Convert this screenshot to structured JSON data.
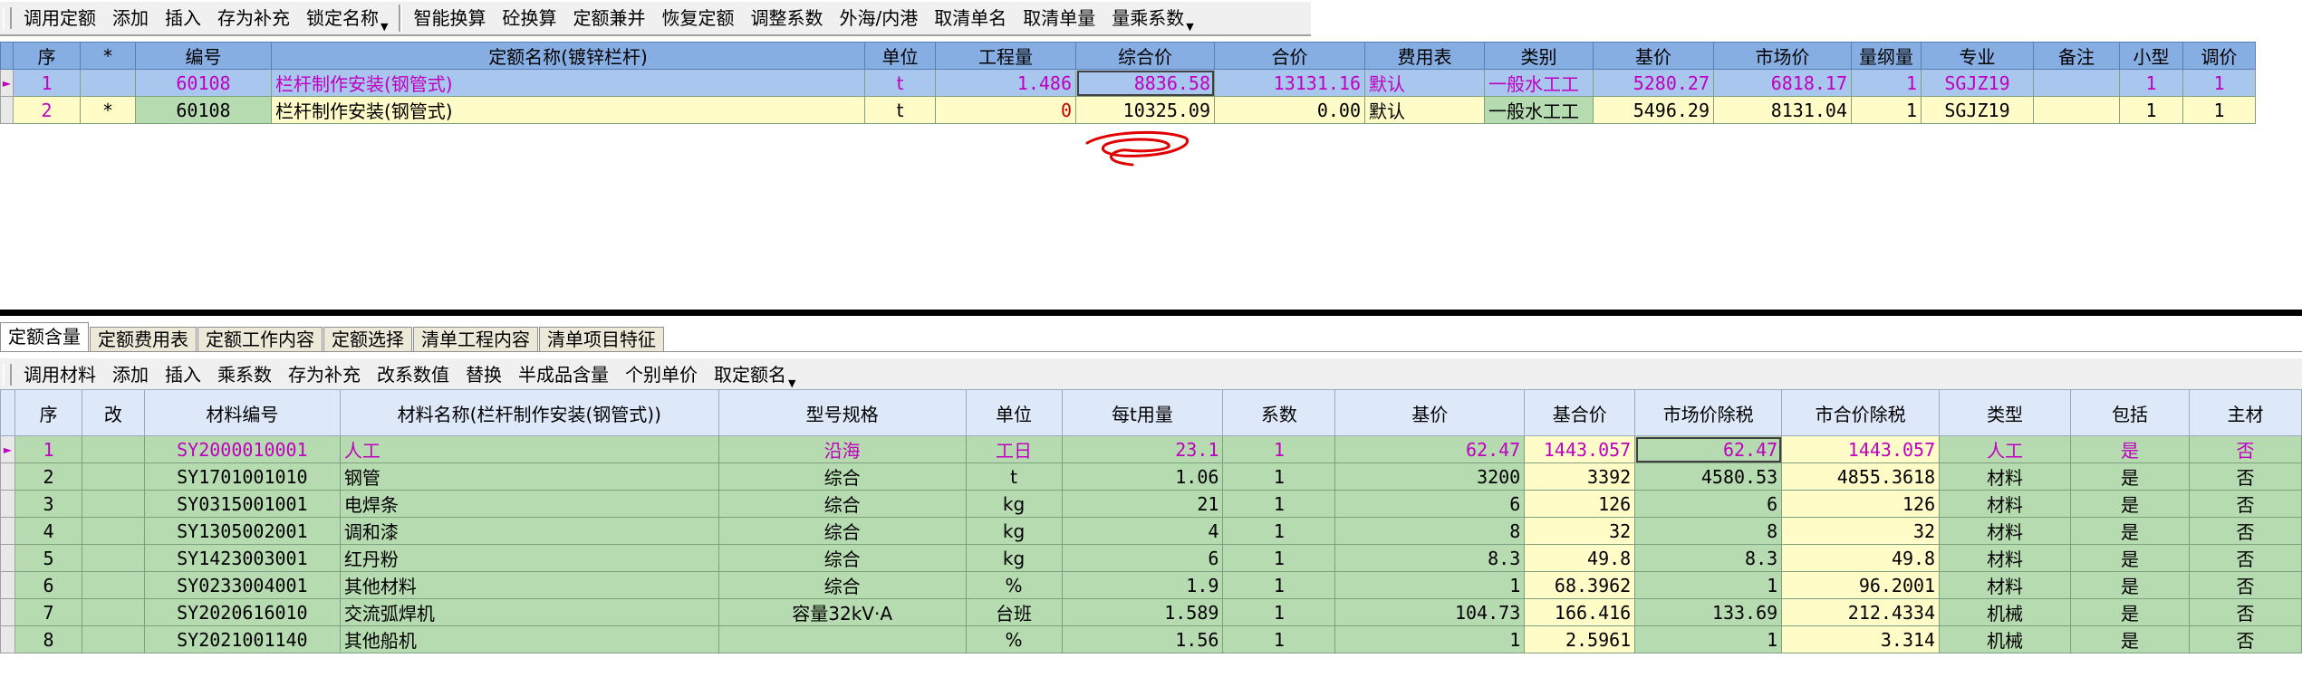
{
  "toolbar_top": {
    "buttons": [
      "调用定额",
      "添加",
      "插入",
      "存为补充",
      "锁定名称",
      "智能换算",
      "砼换算",
      "定额兼并",
      "恢复定额",
      "调整系数",
      "外海/内港",
      "取清单名",
      "取清单量",
      "量乘系数"
    ]
  },
  "top_grid": {
    "headers": [
      "序",
      "*",
      "编号",
      "定额名称(镀锌栏杆)",
      "单位",
      "工程量",
      "综合价",
      "合价",
      "费用表",
      "类别",
      "基价",
      "市场价",
      "量纲量",
      "专业",
      "备注",
      "小型",
      "调价"
    ],
    "rows": [
      {
        "seq": "1",
        "star": "",
        "code": "60108",
        "name": "栏杆制作安装(钢管式)",
        "unit": "t",
        "qty": "1.486",
        "composite": "8836.58",
        "total": "13131.16",
        "fee_table": "默认",
        "category": "一般水工工",
        "base_price": "5280.27",
        "market_price": "6818.17",
        "dim_qty": "1",
        "specialty": "SGJZ19",
        "note": "",
        "small": "1",
        "adjust": "1"
      },
      {
        "seq": "2",
        "star": "*",
        "code": "60108",
        "name": "栏杆制作安装(钢管式)",
        "unit": "t",
        "qty": "0",
        "composite": "10325.09",
        "total": "0.00",
        "fee_table": "默认",
        "category": "一般水工工",
        "base_price": "5496.29",
        "market_price": "8131.04",
        "dim_qty": "1",
        "specialty": "SGJZ19",
        "note": "",
        "small": "1",
        "adjust": "1"
      }
    ]
  },
  "tabs": [
    "定额含量",
    "定额费用表",
    "定额工作内容",
    "定额选择",
    "清单工程内容",
    "清单项目特征"
  ],
  "toolbar_bottom": {
    "buttons": [
      "调用材料",
      "添加",
      "插入",
      "乘系数",
      "存为补充",
      "改系数值",
      "替换",
      "半成品含量",
      "个别单价",
      "取定额名"
    ]
  },
  "bottom_grid": {
    "headers": [
      "序",
      "改",
      "材料编号",
      "材料名称(栏杆制作安装(钢管式))",
      "型号规格",
      "单位",
      "每t用量",
      "系数",
      "基价",
      "基合价",
      "市场价除税",
      "市合价除税",
      "类型",
      "包括",
      "主材"
    ],
    "rows": [
      {
        "seq": "1",
        "mod": "",
        "code": "SY2000010001",
        "name": "人工",
        "spec": "沿海",
        "unit": "工日",
        "usage": "23.1",
        "coef": "1",
        "base": "62.47",
        "base_total": "1443.057",
        "market": "62.47",
        "market_total": "1443.057",
        "type": "人工",
        "incl": "是",
        "main": "否"
      },
      {
        "seq": "2",
        "mod": "",
        "code": "SY1701001010",
        "name": "钢管",
        "spec": "综合",
        "unit": "t",
        "usage": "1.06",
        "coef": "1",
        "base": "3200",
        "base_total": "3392",
        "market": "4580.53",
        "market_total": "4855.3618",
        "type": "材料",
        "incl": "是",
        "main": "否"
      },
      {
        "seq": "3",
        "mod": "",
        "code": "SY0315001001",
        "name": "电焊条",
        "spec": "综合",
        "unit": "kg",
        "usage": "21",
        "coef": "1",
        "base": "6",
        "base_total": "126",
        "market": "6",
        "market_total": "126",
        "type": "材料",
        "incl": "是",
        "main": "否"
      },
      {
        "seq": "4",
        "mod": "",
        "code": "SY1305002001",
        "name": "调和漆",
        "spec": "综合",
        "unit": "kg",
        "usage": "4",
        "coef": "1",
        "base": "8",
        "base_total": "32",
        "market": "8",
        "market_total": "32",
        "type": "材料",
        "incl": "是",
        "main": "否"
      },
      {
        "seq": "5",
        "mod": "",
        "code": "SY1423003001",
        "name": "红丹粉",
        "spec": "综合",
        "unit": "kg",
        "usage": "6",
        "coef": "1",
        "base": "8.3",
        "base_total": "49.8",
        "market": "8.3",
        "market_total": "49.8",
        "type": "材料",
        "incl": "是",
        "main": "否"
      },
      {
        "seq": "6",
        "mod": "",
        "code": "SY0233004001",
        "name": "其他材料",
        "spec": "综合",
        "unit": "%",
        "usage": "1.9",
        "coef": "1",
        "base": "1",
        "base_total": "68.3962",
        "market": "1",
        "market_total": "96.2001",
        "type": "材料",
        "incl": "是",
        "main": "否"
      },
      {
        "seq": "7",
        "mod": "",
        "code": "SY2020616010",
        "name": "交流弧焊机",
        "spec": "容量32kV·A",
        "unit": "台班",
        "usage": "1.589",
        "coef": "1",
        "base": "104.73",
        "base_total": "166.416",
        "market": "133.69",
        "market_total": "212.4334",
        "type": "机械",
        "incl": "是",
        "main": "否"
      },
      {
        "seq": "8",
        "mod": "",
        "code": "SY2021001140",
        "name": "其他船机",
        "spec": "",
        "unit": "%",
        "usage": "1.56",
        "coef": "1",
        "base": "1",
        "base_total": "2.5961",
        "market": "1",
        "market_total": "3.314",
        "type": "机械",
        "incl": "是",
        "main": "否"
      }
    ]
  },
  "colors": {
    "header_blue": "#87aee3",
    "row_green": "#b7dbb0",
    "cell_yellow": "#fffcc8",
    "magenta": "#c000c0",
    "annotation_red": "#e00000"
  }
}
